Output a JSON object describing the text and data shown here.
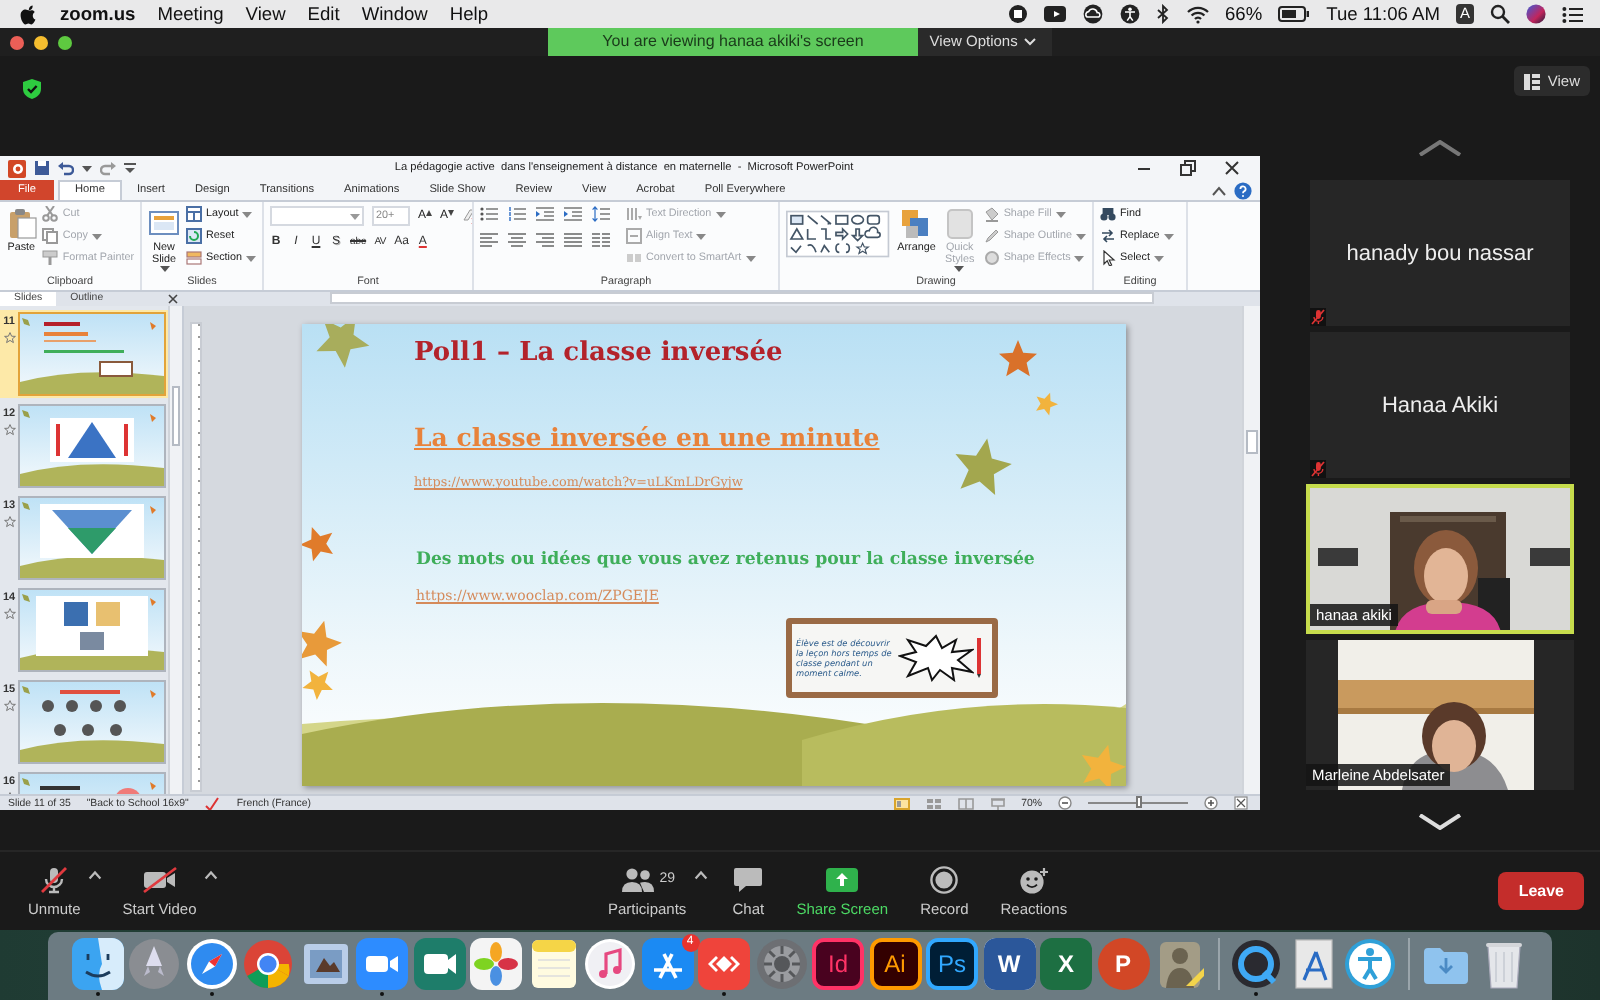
{
  "menu_bar": {
    "app_name": "zoom.us",
    "menus": [
      "Meeting",
      "View",
      "Edit",
      "Window",
      "Help"
    ],
    "battery": "66%",
    "clock": "Tue 11:06 AM",
    "input_source": "A"
  },
  "zoom_bar": {
    "banner": "You are viewing hanaa akiki's screen",
    "view_options": "View Options"
  },
  "view_button": "View",
  "powerpoint": {
    "title": "La pédagogie active  dans l'enseignement à distance  en maternelle  -  Microsoft PowerPoint",
    "tabs": [
      {
        "label": "File",
        "kind": "file",
        "selected": false
      },
      {
        "label": "Home",
        "kind": "tab",
        "selected": true
      },
      {
        "label": "Insert",
        "kind": "tab",
        "selected": false
      },
      {
        "label": "Design",
        "kind": "tab",
        "selected": false
      },
      {
        "label": "Transitions",
        "kind": "tab",
        "selected": false
      },
      {
        "label": "Animations",
        "kind": "tab",
        "selected": false
      },
      {
        "label": "Slide Show",
        "kind": "tab",
        "selected": false
      },
      {
        "label": "Review",
        "kind": "tab",
        "selected": false
      },
      {
        "label": "View",
        "kind": "tab",
        "selected": false
      },
      {
        "label": "Acrobat",
        "kind": "tab",
        "selected": false
      },
      {
        "label": "Poll Everywhere",
        "kind": "tab",
        "selected": false
      }
    ],
    "groups": [
      {
        "label": "Clipboard",
        "kind": "clipboard",
        "large": [
          {
            "label": "Paste",
            "disabled": false,
            "dropdown": false
          }
        ],
        "small": [
          {
            "label": "Cut",
            "disabled": true,
            "dropdown": false
          },
          {
            "label": "Copy",
            "disabled": true,
            "dropdown": true
          },
          {
            "label": "Format Painter",
            "disabled": true,
            "dropdown": false
          }
        ]
      },
      {
        "label": "Slides",
        "kind": "slides",
        "large": [
          {
            "label": "New Slide",
            "disabled": false,
            "dropdown": true
          }
        ],
        "small": [
          {
            "label": "Layout",
            "disabled": false,
            "dropdown": true
          },
          {
            "label": "Reset",
            "disabled": false,
            "dropdown": false
          },
          {
            "label": "Section",
            "disabled": false,
            "dropdown": true
          }
        ]
      },
      {
        "label": "Font",
        "kind": "font",
        "size": "20+",
        "size_buttons": [
          "A",
          "A"
        ],
        "buttons": [
          "B",
          "I",
          "U",
          "S",
          "abc",
          "AV",
          "Aa",
          "A"
        ]
      },
      {
        "label": "Paragraph",
        "kind": "paragraph",
        "small": [
          {
            "label": "Text Direction",
            "disabled": true,
            "dropdown": true
          },
          {
            "label": "Align Text",
            "disabled": true,
            "dropdown": true
          },
          {
            "label": "Convert to SmartArt",
            "disabled": true,
            "dropdown": true
          }
        ]
      },
      {
        "label": "Drawing",
        "kind": "drawing",
        "large": [
          {
            "label": "Arrange",
            "disabled": false,
            "dropdown": false
          },
          {
            "label": "Quick Styles",
            "disabled": true,
            "dropdown": true
          }
        ],
        "small": [
          {
            "label": "Shape Fill",
            "disabled": true,
            "dropdown": true
          },
          {
            "label": "Shape Outline",
            "disabled": true,
            "dropdown": true
          },
          {
            "label": "Shape Effects",
            "disabled": true,
            "dropdown": true
          }
        ]
      },
      {
        "label": "Editing",
        "kind": "editing",
        "small": [
          {
            "label": "Find",
            "disabled": false,
            "dropdown": false
          },
          {
            "label": "Replace",
            "disabled": false,
            "dropdown": true
          },
          {
            "label": "Select",
            "disabled": false,
            "dropdown": true
          }
        ]
      }
    ],
    "pane_tabs": [
      {
        "label": "Slides",
        "selected": true
      },
      {
        "label": "Outline",
        "selected": false
      }
    ],
    "thumbnails": [
      {
        "number": "11",
        "selected": true
      },
      {
        "number": "12",
        "selected": false
      },
      {
        "number": "13",
        "selected": false
      },
      {
        "number": "14",
        "selected": false
      },
      {
        "number": "15",
        "selected": false
      },
      {
        "number": "16",
        "selected": false
      }
    ],
    "slide": {
      "title": "Poll1 – La classe inversée",
      "heading": "La classe inversée en une minute",
      "video_link": "https://www.youtube.com/watch?v=uLKmLDrGyjw",
      "question": "Des mots ou idées que vous avez retenus pour la classe inversée",
      "poll_link": "https://www.wooclap.com/ZPGEJE",
      "note": "Élève est de découvrir la leçon hors temps de classe pendant un moment calme."
    },
    "status_bar": {
      "slide_count": "Slide 11 of 35",
      "theme": "\"Back to School 16x9\"",
      "language": "French (France)",
      "zoom": "70%",
      "zoom_slider": {
        "level": 0.5
      }
    }
  },
  "participants": [
    {
      "name": "hanady bou nassar",
      "kind": "name",
      "muted": true,
      "speaking": false
    },
    {
      "name": "Hanaa Akiki",
      "kind": "name",
      "muted": true,
      "speaking": false
    },
    {
      "name": "hanaa akiki",
      "kind": "video",
      "muted": false,
      "speaking": true
    },
    {
      "name": "Marleine Abdelsater",
      "kind": "video",
      "muted": false,
      "speaking": false
    }
  ],
  "toolbar": [
    {
      "label": "Unmute",
      "kind": "mic",
      "off": true,
      "caret": true
    },
    {
      "label": "Start Video",
      "kind": "camera",
      "off": true,
      "caret": true
    },
    {
      "label": "Participants",
      "kind": "participants",
      "count": "29",
      "off": false,
      "caret": true
    },
    {
      "label": "Chat",
      "kind": "chat",
      "off": false,
      "caret": false
    },
    {
      "label": "Share Screen",
      "kind": "share",
      "off": false,
      "caret": false
    },
    {
      "label": "Record",
      "kind": "record",
      "off": false,
      "caret": false
    },
    {
      "label": "Reactions",
      "kind": "reactions",
      "off": false,
      "caret": false
    }
  ],
  "leave": "Leave",
  "dock": [
    {
      "kind": "finder",
      "running": true
    },
    {
      "kind": "launchpad",
      "running": false
    },
    {
      "kind": "safari",
      "running": true
    },
    {
      "kind": "chrome",
      "running": false
    },
    {
      "kind": "mail",
      "running": false
    },
    {
      "kind": "zoom",
      "running": true
    },
    {
      "kind": "meet",
      "running": false
    },
    {
      "kind": "photos",
      "running": false
    },
    {
      "kind": "notes",
      "running": false
    },
    {
      "kind": "music",
      "running": false
    },
    {
      "kind": "store",
      "running": false,
      "badge": "4"
    },
    {
      "kind": "remote",
      "running": true
    },
    {
      "kind": "settings",
      "running": false
    },
    {
      "kind": "indesign",
      "label": "Id",
      "running": false
    },
    {
      "kind": "illustrator",
      "label": "Ai",
      "running": false
    },
    {
      "kind": "photoshop",
      "label": "Ps",
      "running": false
    },
    {
      "kind": "word",
      "label": "W",
      "running": false
    },
    {
      "kind": "excel",
      "label": "X",
      "running": false
    },
    {
      "kind": "powerpoint",
      "label": "P",
      "running": false
    },
    {
      "kind": "game",
      "running": false
    },
    {
      "kind": "divider"
    },
    {
      "kind": "quicktime",
      "running": true
    },
    {
      "kind": "xcode",
      "running": false
    },
    {
      "kind": "accessibility",
      "running": false
    },
    {
      "kind": "divider"
    },
    {
      "kind": "downloads",
      "running": false
    },
    {
      "kind": "trash",
      "running": false
    }
  ]
}
